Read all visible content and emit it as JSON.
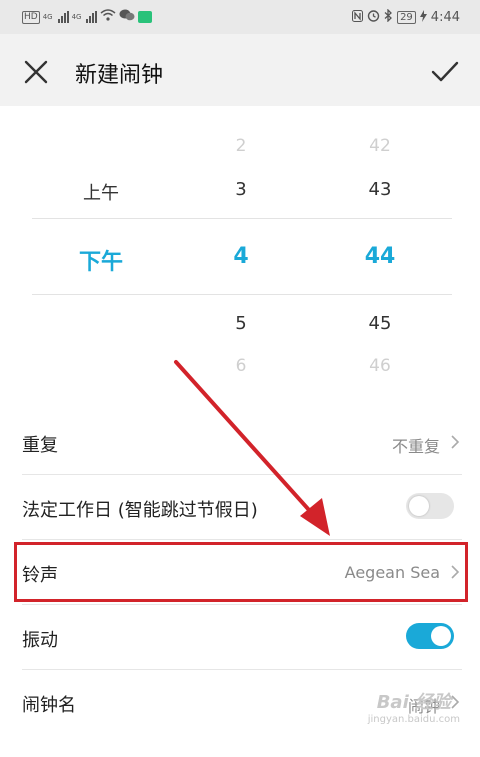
{
  "status_bar": {
    "hd": "HD",
    "net1": "4G",
    "net2": "4G",
    "battery": "29",
    "time": "4:44"
  },
  "header": {
    "title": "新建闹钟"
  },
  "picker": {
    "ampm": [
      "",
      "上午",
      "下午",
      "",
      ""
    ],
    "hours": [
      "2",
      "3",
      "4",
      "5",
      "6"
    ],
    "minutes": [
      "42",
      "43",
      "44",
      "45",
      "46"
    ]
  },
  "settings": {
    "repeat": {
      "label": "重复",
      "value": "不重复"
    },
    "holiday": {
      "label": "法定工作日 (智能跳过节假日)",
      "toggle": "off"
    },
    "ringtone": {
      "label": "铃声",
      "value": "Aegean Sea"
    },
    "vibrate": {
      "label": "振动",
      "toggle": "on"
    },
    "name": {
      "label": "闹钟名",
      "value": "闹钟"
    }
  },
  "watermark": {
    "main": "Bai 经验",
    "sub": "jingyan.baidu.com"
  },
  "colors": {
    "accent": "#1aa9d8",
    "highlight": "#d2232a"
  }
}
